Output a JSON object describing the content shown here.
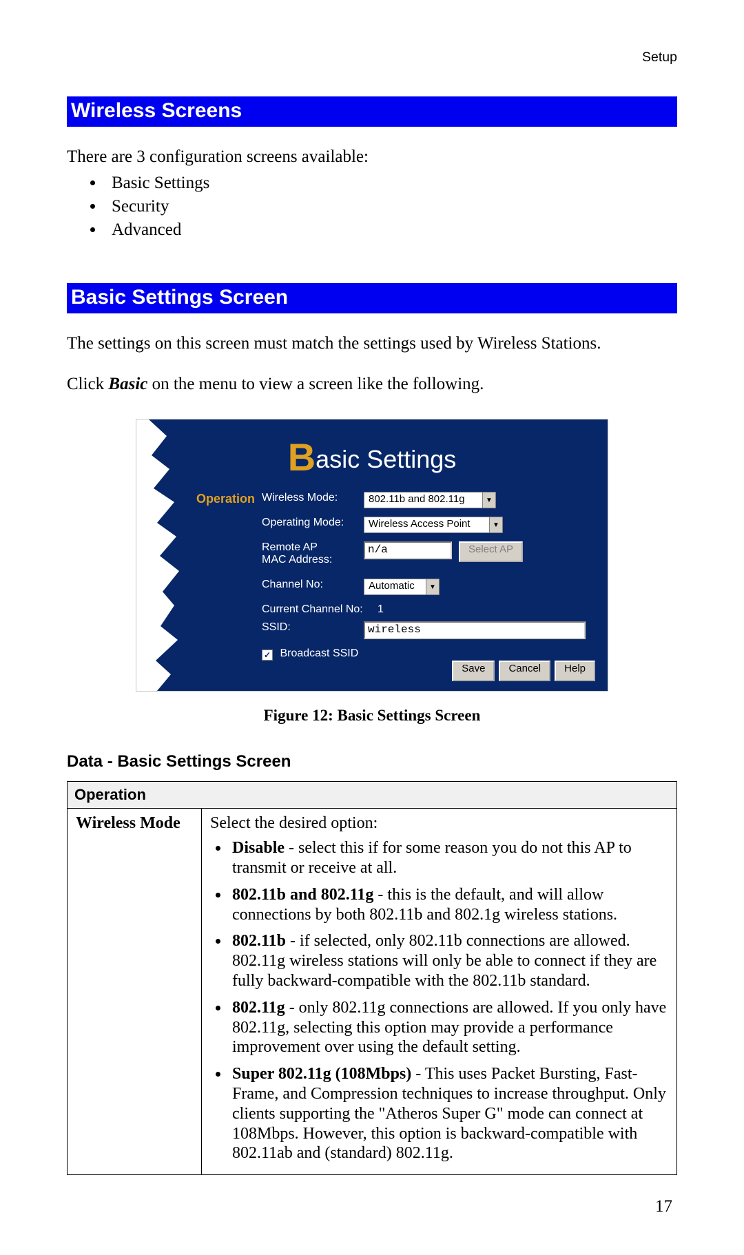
{
  "header": {
    "section_label": "Setup"
  },
  "section1": {
    "title": "Wireless Screens",
    "intro": "There are 3 configuration screens available:",
    "items": [
      "Basic Settings",
      "Security",
      "Advanced"
    ]
  },
  "section2": {
    "title": "Basic Settings Screen",
    "p1": "The settings on this screen must match the settings used by Wireless Stations.",
    "p2_a": "Click ",
    "p2_b": "Basic",
    "p2_c": " on the menu to view a screen like the following."
  },
  "panel": {
    "title_prefix_letter": "B",
    "title_rest": "asic Settings",
    "section_label": "Operation",
    "rows": {
      "wireless_mode_lbl": "Wireless Mode:",
      "wireless_mode_val": "802.11b and 802.11g",
      "operating_mode_lbl": "Operating Mode:",
      "operating_mode_val": "Wireless Access Point",
      "remote_ap_lbl1": "Remote AP",
      "remote_ap_lbl2": "MAC Address:",
      "remote_ap_val": "n/a",
      "select_ap_btn": "Select AP",
      "channel_no_lbl": "Channel No:",
      "channel_no_val": "Automatic",
      "current_channel_lbl": "Current Channel No:",
      "current_channel_val": "1",
      "ssid_lbl": "SSID:",
      "ssid_val": "wireless",
      "broadcast_lbl": "Broadcast SSID"
    },
    "buttons": {
      "save": "Save",
      "cancel": "Cancel",
      "help": "Help"
    }
  },
  "figure_caption": "Figure 12: Basic Settings Screen",
  "subhead": "Data - Basic Settings Screen",
  "table": {
    "section_header": "Operation",
    "row_name": "Wireless Mode",
    "intro": "Select the desired option:",
    "items": [
      {
        "b": "Disable",
        "t": " - select this if for some reason you do not this AP to transmit or receive at all."
      },
      {
        "b": "802.11b and 802.11g",
        "t": " - this is the default, and will allow connections by both 802.11b and 802.1g wireless stations."
      },
      {
        "b": "802.11b",
        "t": " - if selected, only 802.11b connections are allowed. 802.11g wireless stations will only be able to connect if they are fully backward-compatible with the 802.11b standard."
      },
      {
        "b": "802.11g",
        "t": " - only 802.11g connections are allowed. If you only have 802.11g, selecting this option may provide a performance improvement over using the default setting."
      },
      {
        "b": "Super 802.11g (108Mbps)",
        "t": " - This uses Packet Bursting, Fast-Frame, and Compression techniques to increase throughput. Only clients supporting the \"Atheros Super G\" mode can connect at 108Mbps. However, this option is backward-compatible with 802.11ab and (standard) 802.11g."
      }
    ]
  },
  "page_number": "17"
}
